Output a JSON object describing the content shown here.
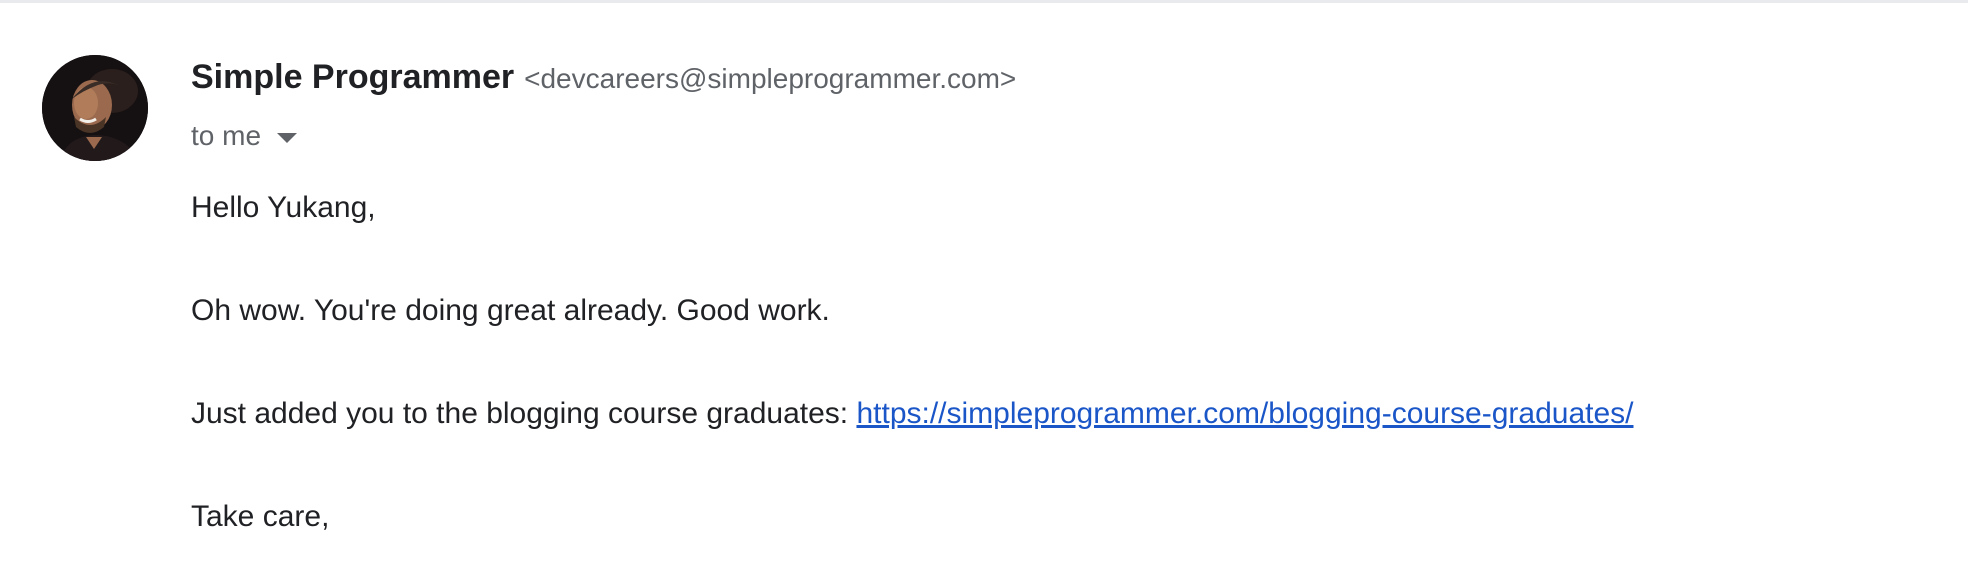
{
  "message": {
    "sender": {
      "name": "Simple Programmer",
      "email": "<devcareers@simpleprogrammer.com>",
      "avatar": "sender-photo"
    },
    "recipient_label": "to me",
    "recipient_toggle_icon": "caret-down-icon",
    "body": {
      "greeting": "Hello Yukang,",
      "paragraph_1": "Oh wow. You're doing great already. Good work.",
      "paragraph_2_text": "Just added you to the blogging course graduates: ",
      "paragraph_2_link": "https://simpleprogrammer.com/blogging-course-graduates/",
      "closing": "Take care,"
    }
  },
  "colors": {
    "text_primary": "#202124",
    "text_secondary": "#5f6368",
    "link": "#1a56c8",
    "divider": "#e8eaed"
  }
}
